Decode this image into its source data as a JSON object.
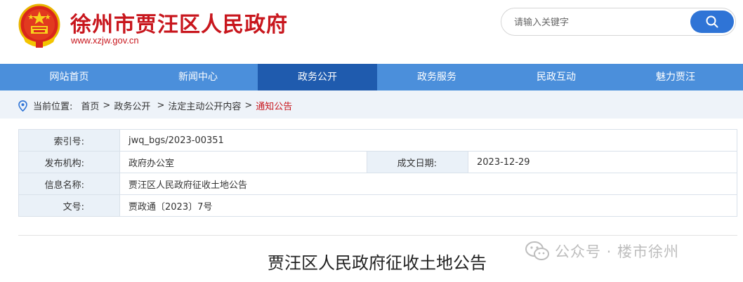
{
  "header": {
    "site_title": "徐州市贾汪区人民政府",
    "site_url": "www.xzjw.gov.cn",
    "search_placeholder": "请输入关键字"
  },
  "nav": [
    {
      "label": "网站首页",
      "active": false
    },
    {
      "label": "新闻中心",
      "active": false
    },
    {
      "label": "政务公开",
      "active": true
    },
    {
      "label": "政务服务",
      "active": false
    },
    {
      "label": "民政互动",
      "active": false
    },
    {
      "label": "魅力贾汪",
      "active": false
    }
  ],
  "breadcrumb": {
    "prefix": "当前位置:",
    "items": [
      "首页",
      "政务公开",
      "法定主动公开内容",
      "通知公告"
    ]
  },
  "info": {
    "index_label": "索引号:",
    "index_value": "jwq_bgs/2023-00351",
    "publisher_label": "发布机构:",
    "publisher_value": "政府办公室",
    "date_label": "成文日期:",
    "date_value": "2023-12-29",
    "name_label": "信息名称:",
    "name_value": "贾汪区人民政府征收土地公告",
    "docno_label": "文号:",
    "docno_value": "贾政通〔2023〕7号"
  },
  "document": {
    "title": "贾汪区人民政府征收土地公告"
  },
  "watermark": {
    "text": "公众号 · 楼市徐州"
  },
  "colors": {
    "brand_red": "#c8161d",
    "nav_blue": "#4b8fdb",
    "nav_active": "#1f5bae",
    "search_blue": "#2f74d6"
  }
}
